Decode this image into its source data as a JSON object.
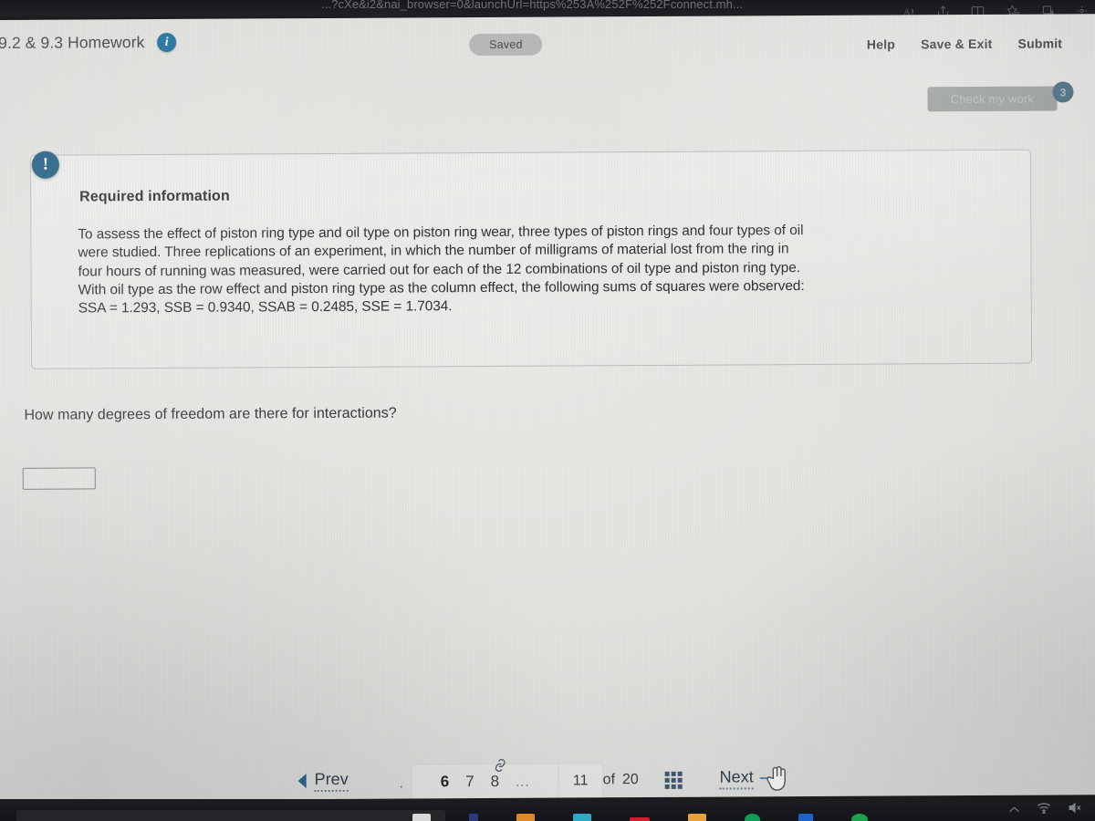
{
  "browser": {
    "url_text": "...?cXe&i2&nai_browser=0&launchUrl=https%253A%252F%252Fconnect.mh...",
    "icons": [
      "read-aloud-icon",
      "share-icon",
      "split-screen-icon",
      "favorites-icon",
      "collections-icon",
      "settings-icon"
    ]
  },
  "header": {
    "assignment_title": "9.2 & 9.3 Homework",
    "info_badge": "i",
    "saved_label": "Saved",
    "actions": [
      {
        "label": "Help",
        "name": "help-link"
      },
      {
        "label": "Save & Exit",
        "name": "save-and-exit-link"
      },
      {
        "label": "Submit",
        "name": "submit-link"
      }
    ]
  },
  "check_my_work": {
    "label": "Check my work",
    "attempts_badge": "3"
  },
  "required_information": {
    "icon": "!",
    "title": "Required information",
    "lines": [
      "To assess the effect of piston ring type and oil type on piston ring wear, three types of piston rings and four types of oil",
      "were studied. Three replications of an experiment, in which the number of milligrams of material lost from the ring in",
      "four hours of running was measured, were carried out for each of the 12 combinations of oil type and piston ring type.",
      "With oil type as the row effect and piston ring type as the column effect, the following sums of squares were observed:",
      "SSA = 1.293, SSB = 0.9340, SSAB = 0.2485, SSE = 1.7034."
    ]
  },
  "question": {
    "prompt": "How many degrees of freedom are there for interactions?",
    "answer_value": "",
    "answer_placeholder": ""
  },
  "pager": {
    "prev_label": "Prev",
    "next_label": "Next",
    "pages": [
      {
        "label": "6",
        "current": true
      },
      {
        "label": "7",
        "current": false
      },
      {
        "label": "8",
        "current": false
      }
    ],
    "ellipsis": "...",
    "current_page": "11",
    "of_label": "of",
    "total_pages": "20",
    "grid_icon": "grid-view-icon",
    "chain_icon": "link-icon"
  },
  "taskbar": {
    "tray_icons": [
      "show-hidden-icons",
      "wifi-icon",
      "volume-muted-icon"
    ]
  },
  "colors": {
    "accent_blue": "#1f5d80",
    "link_blue": "#2b5f93",
    "text_dark": "#2d3136",
    "page_bg": "#e4e4e1"
  }
}
